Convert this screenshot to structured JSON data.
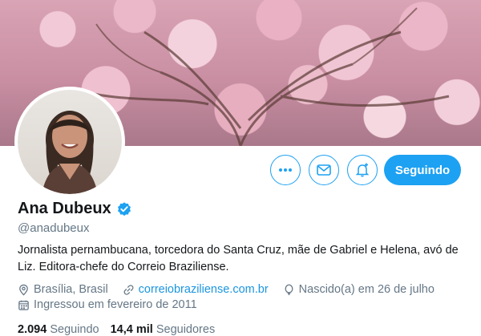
{
  "profile": {
    "name": "Ana Dubeux",
    "handle": "@anadubeux",
    "bio": "Jornalista pernambucana, torcedora do Santa Cruz, mãe de Gabriel e Helena, avó de Liz. Editora-chefe do Correio Braziliense.",
    "location": "Brasília, Brasil",
    "website": "correiobraziliense.com.br",
    "birthday": "Nascido(a) em 26 de julho",
    "joined": "Ingressou em fevereiro de 2011",
    "following_count": "2.094",
    "following_label": "Seguindo",
    "followers_count": "14,4 mil",
    "followers_label": "Seguidores"
  },
  "actions": {
    "more_icon": "more-icon",
    "message_icon": "envelope-icon",
    "notify_icon": "bell-plus-icon",
    "follow_label": "Seguindo"
  },
  "colors": {
    "accent": "#1da1f2",
    "muted": "#657786",
    "link": "#1b95e0"
  }
}
